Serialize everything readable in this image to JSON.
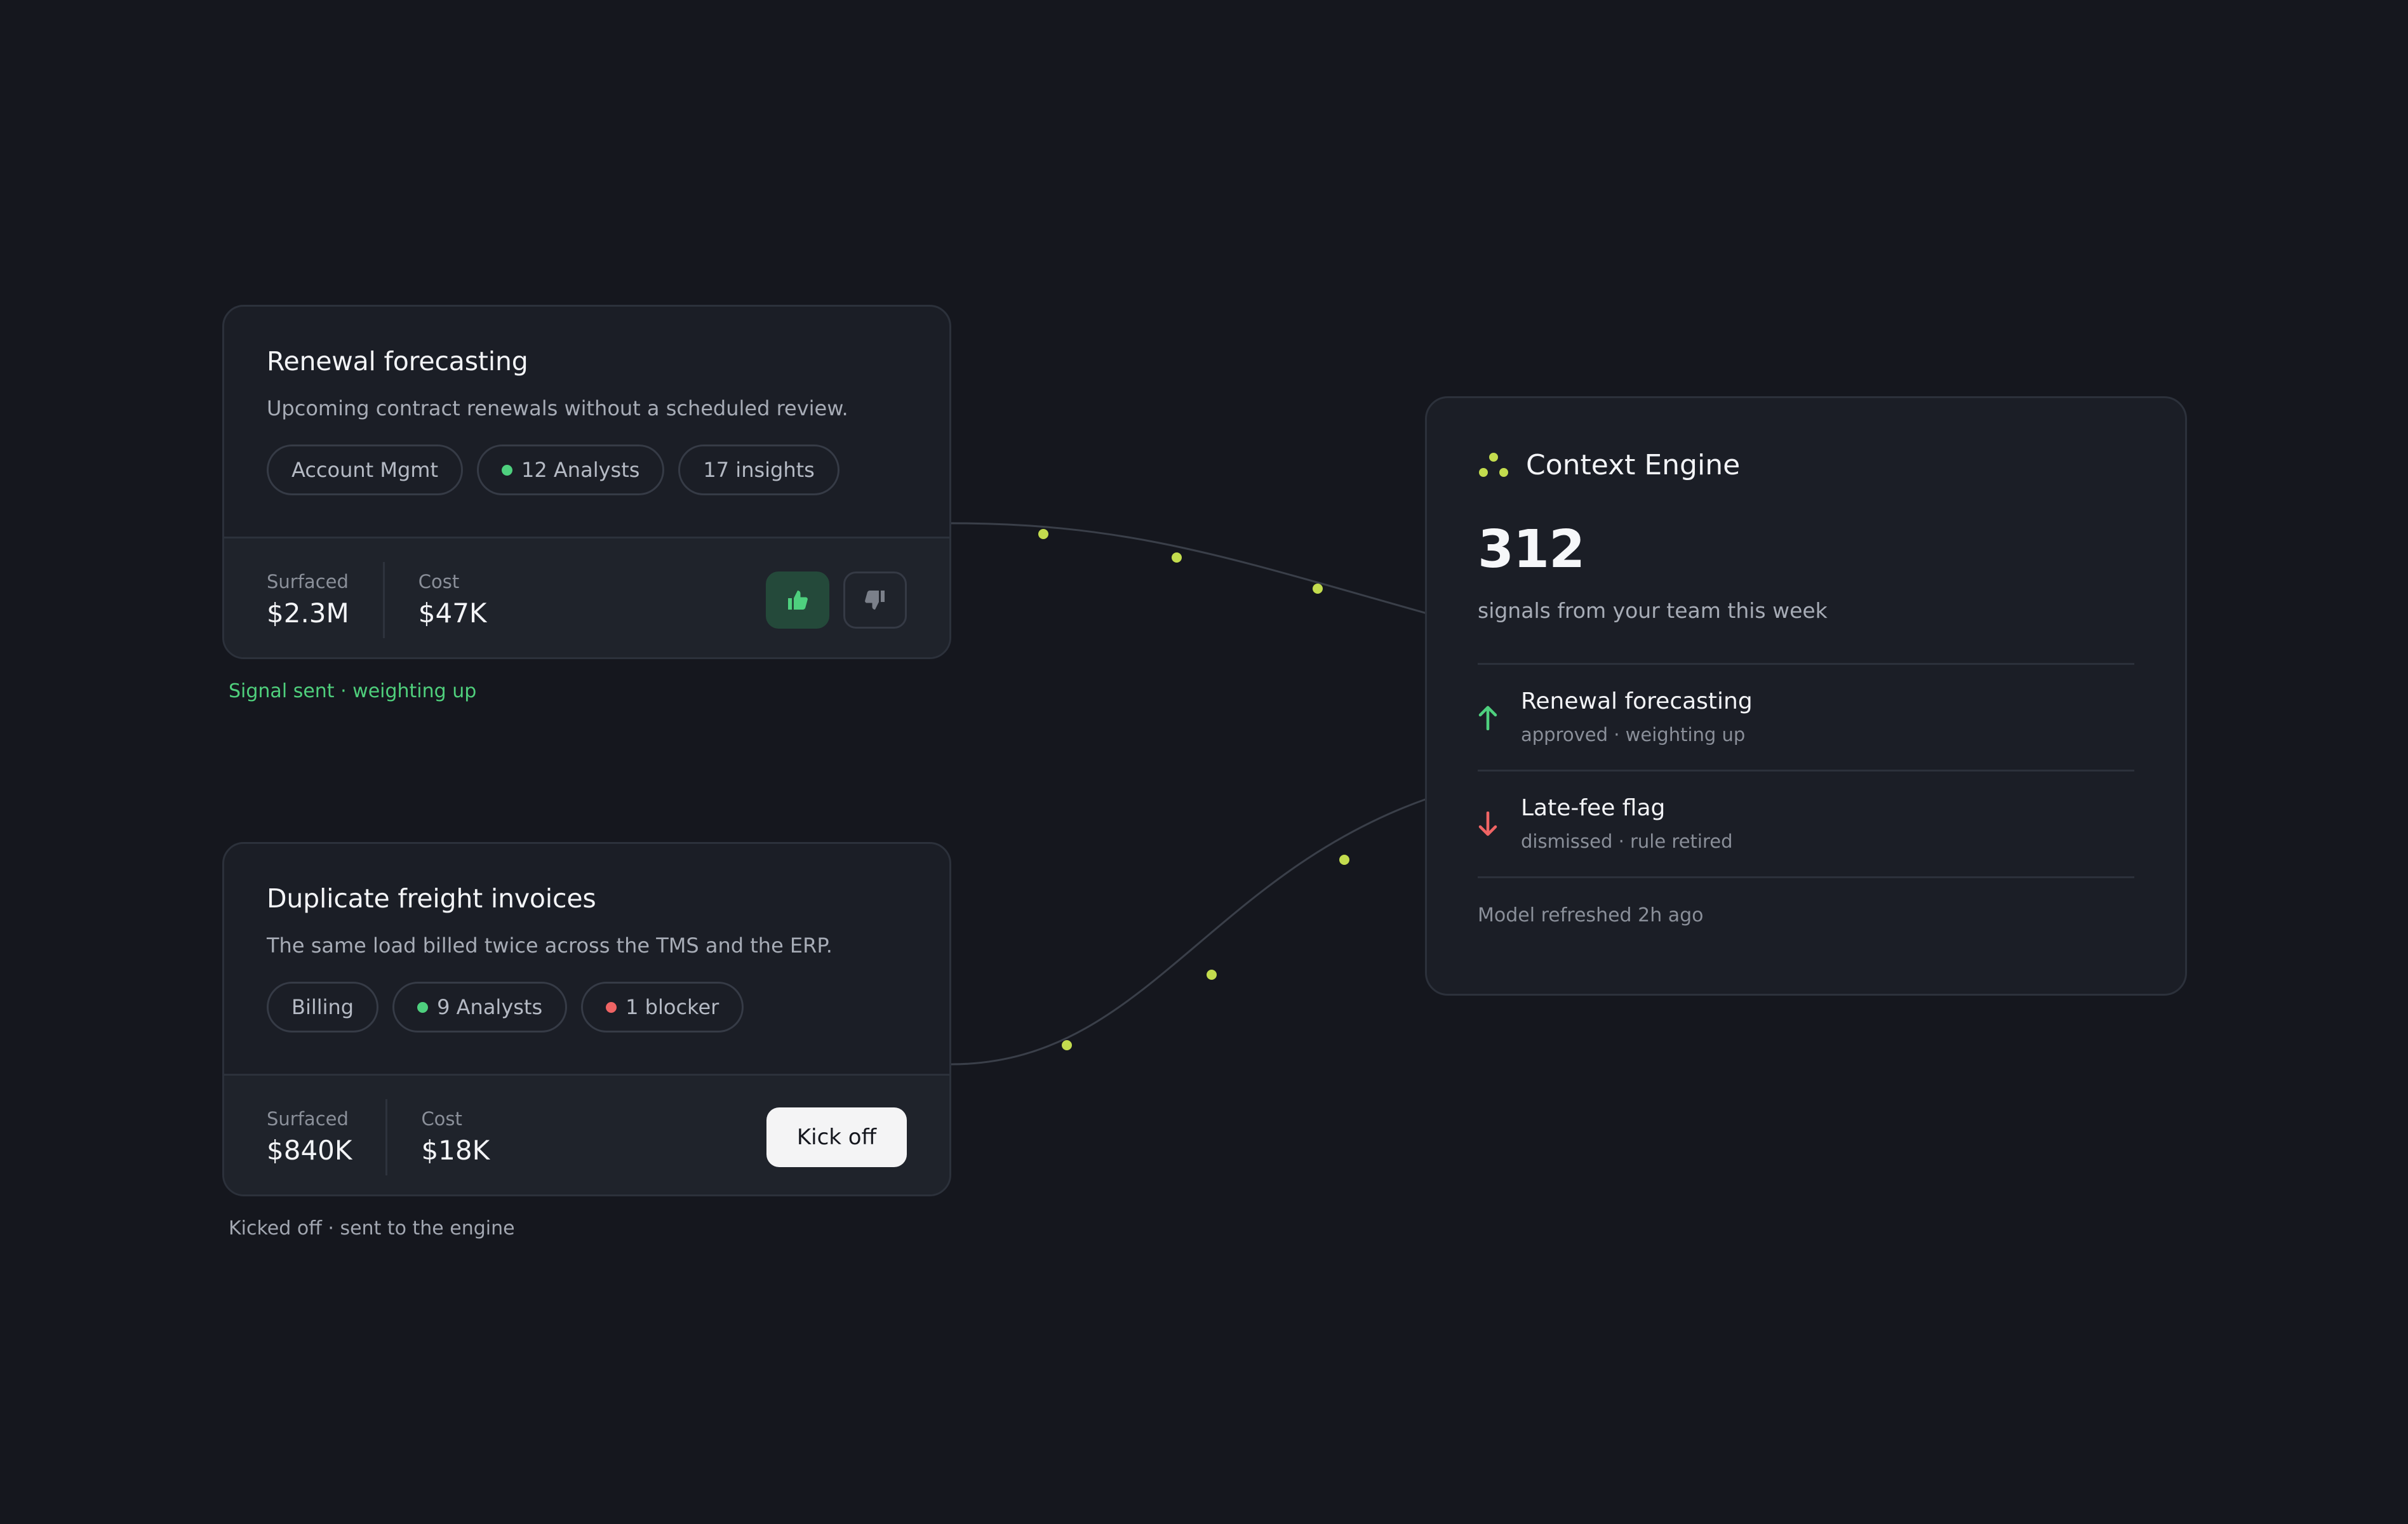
{
  "cards": [
    {
      "title": "Renewal forecasting",
      "description": "Upcoming contract renewals without a scheduled review.",
      "pills": [
        {
          "label": "Account Mgmt",
          "dot": null
        },
        {
          "label": "12 Analysts",
          "dot": "green"
        },
        {
          "label": "17 insights",
          "dot": null
        }
      ],
      "surfaced_label": "Surfaced",
      "surfaced_value": "$2.3M",
      "cost_label": "Cost",
      "cost_value": "$47K",
      "status": "Signal sent · weighting up"
    },
    {
      "title": "Duplicate freight invoices",
      "description": "The same load billed twice across the TMS and the ERP.",
      "pills": [
        {
          "label": "Billing",
          "dot": null
        },
        {
          "label": "9 Analysts",
          "dot": "green"
        },
        {
          "label": "1 blocker",
          "dot": "red"
        }
      ],
      "surfaced_label": "Surfaced",
      "surfaced_value": "$840K",
      "cost_label": "Cost",
      "cost_value": "$18K",
      "action_label": "Kick off",
      "status": "Kicked off · sent to the engine"
    }
  ],
  "engine": {
    "title": "Context Engine",
    "count": "312",
    "subtitle": "signals from your team this week",
    "items": [
      {
        "title": "Renewal forecasting",
        "meta": "approved · weighting up",
        "direction": "up"
      },
      {
        "title": "Late-fee flag",
        "meta": "dismissed · rule retired",
        "direction": "down"
      }
    ],
    "footer": "Model refreshed 2h ago"
  },
  "icons": {
    "vote_up": "thumbs-up-icon",
    "vote_down": "thumbs-down-icon",
    "engine_logo": "three-dots-icon",
    "trend_up": "arrow-up-icon",
    "trend_down": "arrow-down-icon"
  },
  "colors": {
    "background": "#15171e",
    "card": "#1b1e26",
    "accent_lime": "#c3dc4e",
    "positive": "#4ed07e",
    "negative": "#ef6464",
    "vote_up_bg": "#24493a"
  }
}
